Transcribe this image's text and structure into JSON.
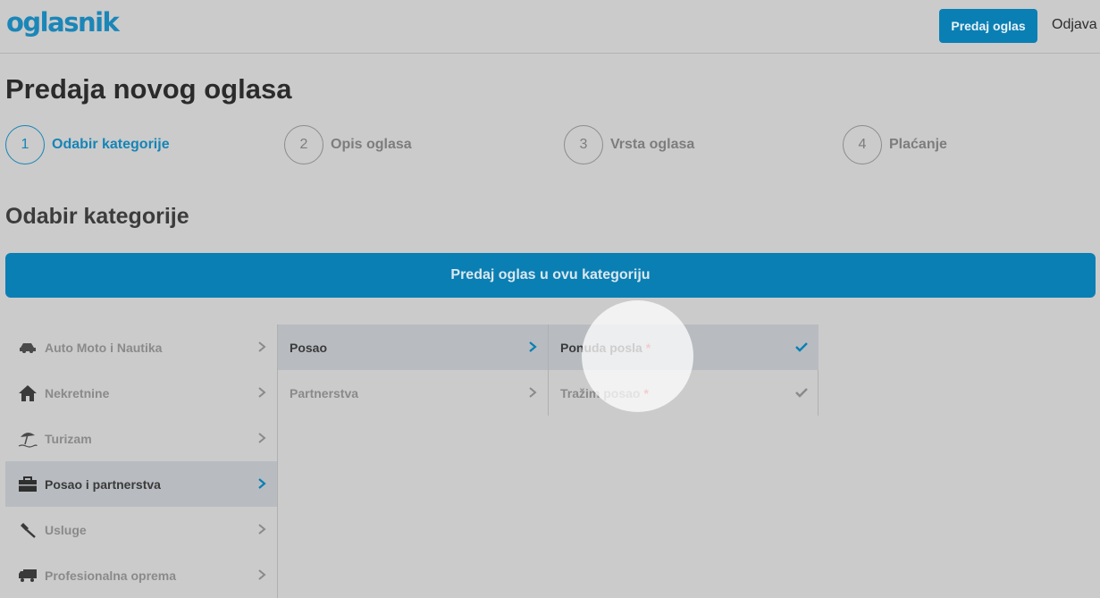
{
  "header": {
    "logo": "oglasnik",
    "submit_button": "Predaj oglas",
    "logout": "Odjava"
  },
  "page_title": "Predaja novog oglasa",
  "steps": [
    {
      "number": "1",
      "label": "Odabir kategorije",
      "active": true
    },
    {
      "number": "2",
      "label": "Opis oglasa",
      "active": false
    },
    {
      "number": "3",
      "label": "Vrsta oglasa",
      "active": false
    },
    {
      "number": "4",
      "label": "Plaćanje",
      "active": false
    }
  ],
  "section_title": "Odabir kategorije",
  "category_button": "Predaj oglas u ovu kategoriju",
  "categories": [
    {
      "label": "Auto Moto i Nautika",
      "icon": "car-icon"
    },
    {
      "label": "Nekretnine",
      "icon": "house-icon"
    },
    {
      "label": "Turizam",
      "icon": "beach-umbrella-icon"
    },
    {
      "label": "Posao i partnerstva",
      "icon": "briefcase-icon",
      "selected": true
    },
    {
      "label": "Usluge",
      "icon": "hammer-icon"
    },
    {
      "label": "Profesionalna oprema",
      "icon": "truck-icon"
    }
  ],
  "subcategories": [
    {
      "label": "Posao",
      "selected": true
    },
    {
      "label": "Partnerstva"
    }
  ],
  "subsubcategories": [
    {
      "label": "Ponuda posla",
      "required": "*",
      "selected": true
    },
    {
      "label": "Tražim posao",
      "required": "*"
    }
  ],
  "colors": {
    "accent": "#0a7fb4",
    "background": "#cbcbcb",
    "selected_row": "#b8bcc0",
    "required": "#d0363b"
  }
}
